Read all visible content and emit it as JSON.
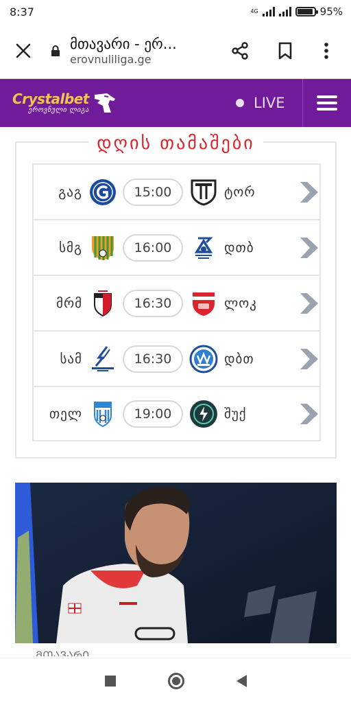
{
  "status_bar": {
    "time": "8:37",
    "network": "4G",
    "battery": "95%",
    "battery_level": 0.95
  },
  "browser": {
    "page_title": "მთავარი - ერ...",
    "domain": "erovnuliliga.ge",
    "icons": [
      "close-icon",
      "lock-icon",
      "share-icon",
      "bookmark-icon",
      "more-vert-icon"
    ]
  },
  "site_header": {
    "logo_text": "Crystalbet",
    "logo_subtext": "ეროვნული ლიგა",
    "live_label": "LIVE",
    "brand_color": "#6f1b9a",
    "logo_color": "#f3c54a"
  },
  "games": {
    "title": "დღის თამაშები",
    "title_color": "#d8262c",
    "rows": [
      {
        "home": "გაგ",
        "time": "15:00",
        "away": "ტორ",
        "home_badge": "gagra-badge-icon",
        "away_badge": "torpedo-badge-icon"
      },
      {
        "home": "სმგ",
        "time": "16:00",
        "away": "დთბ",
        "home_badge": "samgurali-badge-icon",
        "away_badge": "dinamo-tbilisi-badge-icon"
      },
      {
        "home": "მრმ",
        "time": "16:30",
        "away": "ლოკ",
        "home_badge": "merani-badge-icon",
        "away_badge": "lokomotivi-badge-icon"
      },
      {
        "home": "სამ",
        "time": "16:30",
        "away": "დბთ",
        "home_badge": "samtredia-badge-icon",
        "away_badge": "dinamo-batumi-badge-icon"
      },
      {
        "home": "თელ",
        "time": "19:00",
        "away": "შუქ",
        "home_badge": "telavi-badge-icon",
        "away_badge": "shukura-badge-icon"
      }
    ]
  },
  "news": {
    "caption": "ᲛᲗᲐᲕᲐᲠᲘ"
  }
}
